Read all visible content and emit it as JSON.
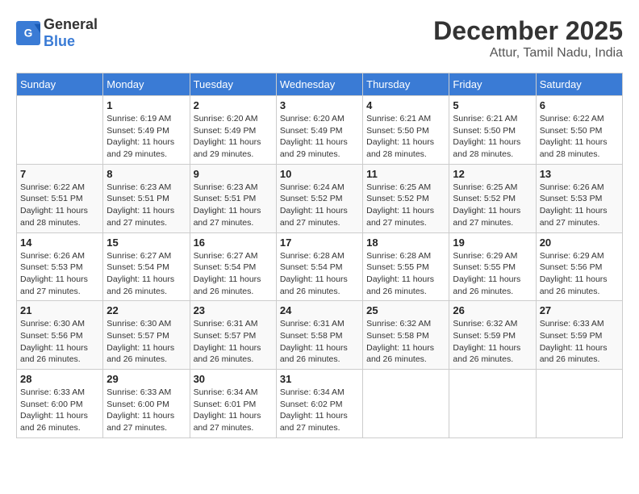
{
  "logo": {
    "text_general": "General",
    "text_blue": "Blue"
  },
  "title": {
    "month": "December 2025",
    "location": "Attur, Tamil Nadu, India"
  },
  "days_of_week": [
    "Sunday",
    "Monday",
    "Tuesday",
    "Wednesday",
    "Thursday",
    "Friday",
    "Saturday"
  ],
  "weeks": [
    [
      {
        "day": "",
        "sunrise": "",
        "sunset": "",
        "daylight": ""
      },
      {
        "day": "1",
        "sunrise": "Sunrise: 6:19 AM",
        "sunset": "Sunset: 5:49 PM",
        "daylight": "Daylight: 11 hours and 29 minutes."
      },
      {
        "day": "2",
        "sunrise": "Sunrise: 6:20 AM",
        "sunset": "Sunset: 5:49 PM",
        "daylight": "Daylight: 11 hours and 29 minutes."
      },
      {
        "day": "3",
        "sunrise": "Sunrise: 6:20 AM",
        "sunset": "Sunset: 5:49 PM",
        "daylight": "Daylight: 11 hours and 29 minutes."
      },
      {
        "day": "4",
        "sunrise": "Sunrise: 6:21 AM",
        "sunset": "Sunset: 5:50 PM",
        "daylight": "Daylight: 11 hours and 28 minutes."
      },
      {
        "day": "5",
        "sunrise": "Sunrise: 6:21 AM",
        "sunset": "Sunset: 5:50 PM",
        "daylight": "Daylight: 11 hours and 28 minutes."
      },
      {
        "day": "6",
        "sunrise": "Sunrise: 6:22 AM",
        "sunset": "Sunset: 5:50 PM",
        "daylight": "Daylight: 11 hours and 28 minutes."
      }
    ],
    [
      {
        "day": "7",
        "sunrise": "Sunrise: 6:22 AM",
        "sunset": "Sunset: 5:51 PM",
        "daylight": "Daylight: 11 hours and 28 minutes."
      },
      {
        "day": "8",
        "sunrise": "Sunrise: 6:23 AM",
        "sunset": "Sunset: 5:51 PM",
        "daylight": "Daylight: 11 hours and 27 minutes."
      },
      {
        "day": "9",
        "sunrise": "Sunrise: 6:23 AM",
        "sunset": "Sunset: 5:51 PM",
        "daylight": "Daylight: 11 hours and 27 minutes."
      },
      {
        "day": "10",
        "sunrise": "Sunrise: 6:24 AM",
        "sunset": "Sunset: 5:52 PM",
        "daylight": "Daylight: 11 hours and 27 minutes."
      },
      {
        "day": "11",
        "sunrise": "Sunrise: 6:25 AM",
        "sunset": "Sunset: 5:52 PM",
        "daylight": "Daylight: 11 hours and 27 minutes."
      },
      {
        "day": "12",
        "sunrise": "Sunrise: 6:25 AM",
        "sunset": "Sunset: 5:52 PM",
        "daylight": "Daylight: 11 hours and 27 minutes."
      },
      {
        "day": "13",
        "sunrise": "Sunrise: 6:26 AM",
        "sunset": "Sunset: 5:53 PM",
        "daylight": "Daylight: 11 hours and 27 minutes."
      }
    ],
    [
      {
        "day": "14",
        "sunrise": "Sunrise: 6:26 AM",
        "sunset": "Sunset: 5:53 PM",
        "daylight": "Daylight: 11 hours and 27 minutes."
      },
      {
        "day": "15",
        "sunrise": "Sunrise: 6:27 AM",
        "sunset": "Sunset: 5:54 PM",
        "daylight": "Daylight: 11 hours and 26 minutes."
      },
      {
        "day": "16",
        "sunrise": "Sunrise: 6:27 AM",
        "sunset": "Sunset: 5:54 PM",
        "daylight": "Daylight: 11 hours and 26 minutes."
      },
      {
        "day": "17",
        "sunrise": "Sunrise: 6:28 AM",
        "sunset": "Sunset: 5:54 PM",
        "daylight": "Daylight: 11 hours and 26 minutes."
      },
      {
        "day": "18",
        "sunrise": "Sunrise: 6:28 AM",
        "sunset": "Sunset: 5:55 PM",
        "daylight": "Daylight: 11 hours and 26 minutes."
      },
      {
        "day": "19",
        "sunrise": "Sunrise: 6:29 AM",
        "sunset": "Sunset: 5:55 PM",
        "daylight": "Daylight: 11 hours and 26 minutes."
      },
      {
        "day": "20",
        "sunrise": "Sunrise: 6:29 AM",
        "sunset": "Sunset: 5:56 PM",
        "daylight": "Daylight: 11 hours and 26 minutes."
      }
    ],
    [
      {
        "day": "21",
        "sunrise": "Sunrise: 6:30 AM",
        "sunset": "Sunset: 5:56 PM",
        "daylight": "Daylight: 11 hours and 26 minutes."
      },
      {
        "day": "22",
        "sunrise": "Sunrise: 6:30 AM",
        "sunset": "Sunset: 5:57 PM",
        "daylight": "Daylight: 11 hours and 26 minutes."
      },
      {
        "day": "23",
        "sunrise": "Sunrise: 6:31 AM",
        "sunset": "Sunset: 5:57 PM",
        "daylight": "Daylight: 11 hours and 26 minutes."
      },
      {
        "day": "24",
        "sunrise": "Sunrise: 6:31 AM",
        "sunset": "Sunset: 5:58 PM",
        "daylight": "Daylight: 11 hours and 26 minutes."
      },
      {
        "day": "25",
        "sunrise": "Sunrise: 6:32 AM",
        "sunset": "Sunset: 5:58 PM",
        "daylight": "Daylight: 11 hours and 26 minutes."
      },
      {
        "day": "26",
        "sunrise": "Sunrise: 6:32 AM",
        "sunset": "Sunset: 5:59 PM",
        "daylight": "Daylight: 11 hours and 26 minutes."
      },
      {
        "day": "27",
        "sunrise": "Sunrise: 6:33 AM",
        "sunset": "Sunset: 5:59 PM",
        "daylight": "Daylight: 11 hours and 26 minutes."
      }
    ],
    [
      {
        "day": "28",
        "sunrise": "Sunrise: 6:33 AM",
        "sunset": "Sunset: 6:00 PM",
        "daylight": "Daylight: 11 hours and 26 minutes."
      },
      {
        "day": "29",
        "sunrise": "Sunrise: 6:33 AM",
        "sunset": "Sunset: 6:00 PM",
        "daylight": "Daylight: 11 hours and 27 minutes."
      },
      {
        "day": "30",
        "sunrise": "Sunrise: 6:34 AM",
        "sunset": "Sunset: 6:01 PM",
        "daylight": "Daylight: 11 hours and 27 minutes."
      },
      {
        "day": "31",
        "sunrise": "Sunrise: 6:34 AM",
        "sunset": "Sunset: 6:02 PM",
        "daylight": "Daylight: 11 hours and 27 minutes."
      },
      {
        "day": "",
        "sunrise": "",
        "sunset": "",
        "daylight": ""
      },
      {
        "day": "",
        "sunrise": "",
        "sunset": "",
        "daylight": ""
      },
      {
        "day": "",
        "sunrise": "",
        "sunset": "",
        "daylight": ""
      }
    ]
  ]
}
